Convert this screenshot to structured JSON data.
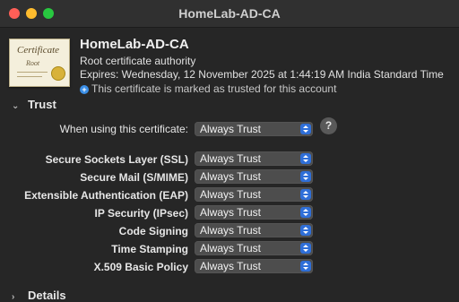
{
  "window": {
    "title": "HomeLab-AD-CA"
  },
  "certificate": {
    "icon_text": "Certificate",
    "icon_subtext": "Root",
    "name": "HomeLab-AD-CA",
    "kind": "Root certificate authority",
    "expires": "Expires: Wednesday, 12 November 2025 at 1:44:19 AM India Standard Time",
    "trusted_note": "This certificate is marked as trusted for this account"
  },
  "trust": {
    "section_label": "Trust",
    "when_using": {
      "label": "When using this certificate:",
      "value": "Always Trust"
    },
    "policies": [
      {
        "label": "Secure Sockets Layer (SSL)",
        "value": "Always Trust"
      },
      {
        "label": "Secure Mail (S/MIME)",
        "value": "Always Trust"
      },
      {
        "label": "Extensible Authentication (EAP)",
        "value": "Always Trust"
      },
      {
        "label": "IP Security (IPsec)",
        "value": "Always Trust"
      },
      {
        "label": "Code Signing",
        "value": "Always Trust"
      },
      {
        "label": "Time Stamping",
        "value": "Always Trust"
      },
      {
        "label": "X.509 Basic Policy",
        "value": "Always Trust"
      }
    ],
    "help_label": "?"
  },
  "details": {
    "section_label": "Details"
  },
  "icons": {
    "close": "close-icon",
    "minimize": "minimize-icon",
    "maximize": "maximize-icon",
    "plus": "plus-circle-icon",
    "chevron": "chevron-down-icon",
    "select_arrows": "updown-arrows-icon"
  },
  "colors": {
    "accent": "#2f6fd8",
    "close": "#ff5f57",
    "minimize": "#febc2e",
    "maximize": "#28c840"
  }
}
